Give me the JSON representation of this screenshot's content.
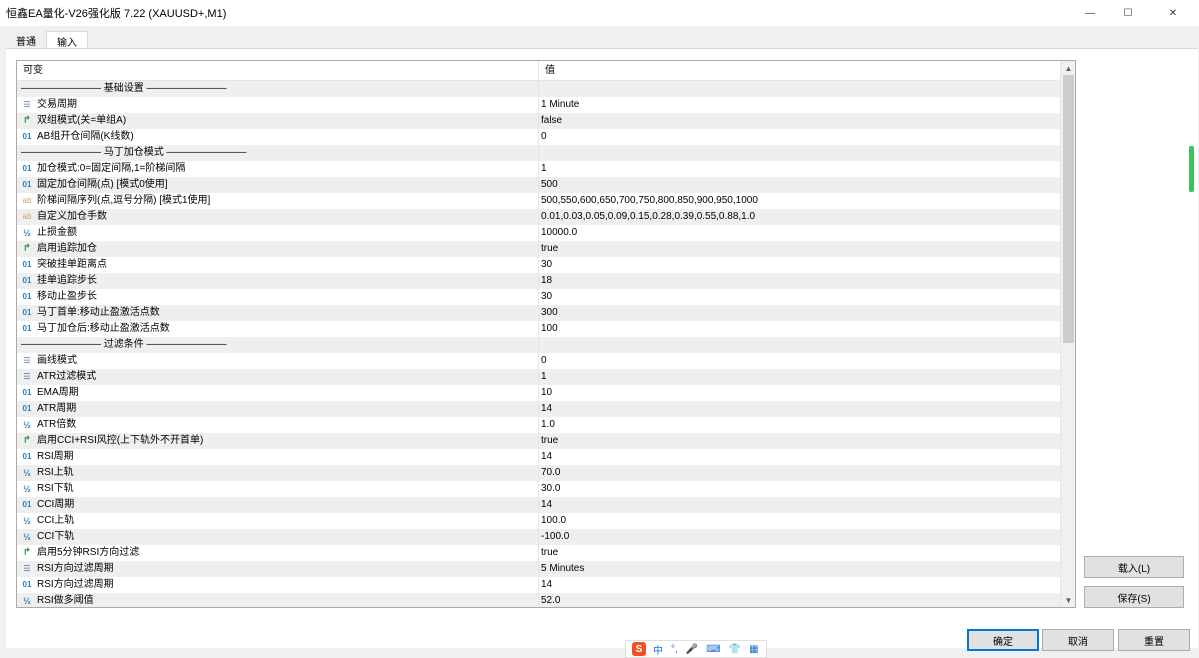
{
  "window": {
    "title": "恒鑫EA量化-V26强化版 7.22 (XAUUSD+,M1)"
  },
  "tabs": [
    {
      "label": "普通"
    },
    {
      "label": "输入"
    }
  ],
  "grid": {
    "col_variable": "可变",
    "col_value": "值",
    "rows": [
      {
        "icon": "none",
        "name": "———————— 基础设置 ————————",
        "value": ""
      },
      {
        "icon": "enum",
        "name": "交易周期",
        "value": "1 Minute"
      },
      {
        "icon": "bool",
        "name": "双组模式(关=单组A)",
        "value": "false"
      },
      {
        "icon": "int",
        "name": "AB组开仓间隔(K线数)",
        "value": "0"
      },
      {
        "icon": "none",
        "name": "———————— 马丁加仓模式 ————————",
        "value": ""
      },
      {
        "icon": "int",
        "name": "加仓模式:0=固定间隔,1=阶梯间隔",
        "value": "1"
      },
      {
        "icon": "int",
        "name": "固定加仓间隔(点) [模式0使用]",
        "value": "500"
      },
      {
        "icon": "str",
        "name": "阶梯间隔序列(点,逗号分隔) [模式1使用]",
        "value": "500,550,600,650,700,750,800,850,900,950,1000"
      },
      {
        "icon": "str",
        "name": "自定义加仓手数",
        "value": "0.01,0.03,0.05,0.09,0.15,0.28,0.39,0.55,0.88,1.0"
      },
      {
        "icon": "dbl",
        "name": "止损金额",
        "value": "10000.0"
      },
      {
        "icon": "bool",
        "name": "启用追踪加仓",
        "value": "true"
      },
      {
        "icon": "int",
        "name": "突破挂单距离点",
        "value": "30"
      },
      {
        "icon": "int",
        "name": "挂单追踪步长",
        "value": "18"
      },
      {
        "icon": "int",
        "name": "移动止盈步长",
        "value": "30"
      },
      {
        "icon": "int",
        "name": "马丁首单:移动止盈激活点数",
        "value": "300"
      },
      {
        "icon": "int",
        "name": "马丁加仓后:移动止盈激活点数",
        "value": "100"
      },
      {
        "icon": "none",
        "name": "———————— 过滤条件 ————————",
        "value": ""
      },
      {
        "icon": "enum",
        "name": "画线模式",
        "value": "0"
      },
      {
        "icon": "enum",
        "name": "ATR过滤模式",
        "value": "1"
      },
      {
        "icon": "int",
        "name": "EMA周期",
        "value": "10"
      },
      {
        "icon": "int",
        "name": "ATR周期",
        "value": "14"
      },
      {
        "icon": "dbl",
        "name": "ATR倍数",
        "value": "1.0"
      },
      {
        "icon": "bool",
        "name": "启用CCI+RSI风控(上下轨外不开首单)",
        "value": "true"
      },
      {
        "icon": "int",
        "name": "RSI周期",
        "value": "14"
      },
      {
        "icon": "dbl",
        "name": "RSI上轨",
        "value": "70.0"
      },
      {
        "icon": "dbl",
        "name": "RSI下轨",
        "value": "30.0"
      },
      {
        "icon": "int",
        "name": "CCI周期",
        "value": "14"
      },
      {
        "icon": "dbl",
        "name": "CCI上轨",
        "value": "100.0"
      },
      {
        "icon": "dbl",
        "name": "CCI下轨",
        "value": "-100.0"
      },
      {
        "icon": "bool",
        "name": "启用5分钟RSI方向过滤",
        "value": "true"
      },
      {
        "icon": "enum",
        "name": "RSI方向过滤周期",
        "value": "5 Minutes"
      },
      {
        "icon": "int",
        "name": "RSI方向过滤周期",
        "value": "14"
      },
      {
        "icon": "dbl",
        "name": "RSI做多阈值",
        "value": "52.0"
      }
    ]
  },
  "icon_glyphs": {
    "int": "01",
    "bool": "↱",
    "str": "ab",
    "dbl": "½",
    "enum": "☰",
    "none": ""
  },
  "buttons": {
    "load": "载入(L)",
    "save": "保存(S)",
    "ok": "确定",
    "cancel": "取消",
    "reset": "重置"
  },
  "ime": {
    "logo": "S",
    "mode": "中"
  }
}
